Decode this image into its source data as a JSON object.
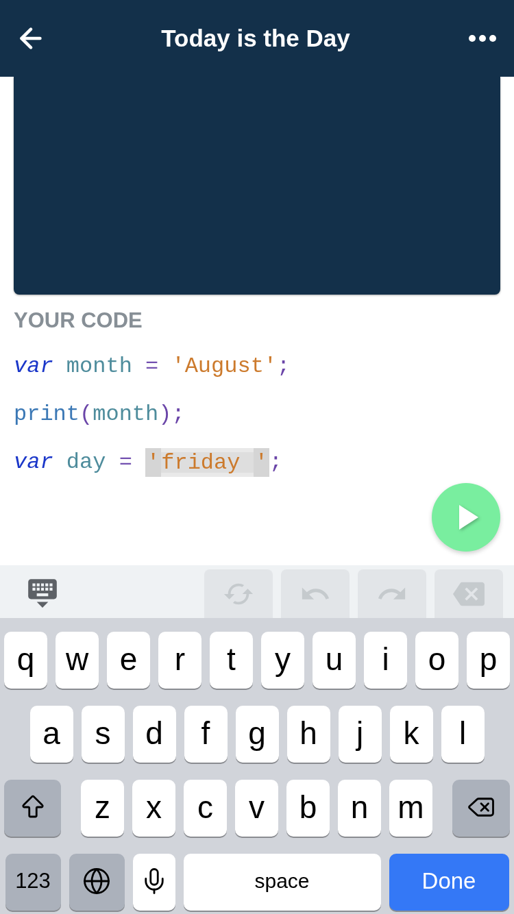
{
  "header": {
    "title": "Today is the Day"
  },
  "code": {
    "heading": "YOUR CODE",
    "lines": [
      {
        "tokens": [
          {
            "text": "var ",
            "kind": "keyword"
          },
          {
            "text": "month ",
            "kind": "identifier"
          },
          {
            "text": "= ",
            "kind": "operator"
          },
          {
            "text": "'August'",
            "kind": "string"
          },
          {
            "text": ";",
            "kind": "punctuation"
          }
        ]
      },
      {
        "tokens": [
          {
            "text": "print",
            "kind": "function"
          },
          {
            "text": "(",
            "kind": "punctuation"
          },
          {
            "text": "month",
            "kind": "identifier"
          },
          {
            "text": ")",
            "kind": "punctuation"
          },
          {
            "text": ";",
            "kind": "punctuation"
          }
        ]
      },
      {
        "tokens": [
          {
            "text": "var ",
            "kind": "keyword"
          },
          {
            "text": "day ",
            "kind": "identifier"
          },
          {
            "text": "= ",
            "kind": "operator"
          },
          {
            "text": "'friday '",
            "kind": "string_field"
          },
          {
            "text": ";",
            "kind": "punctuation"
          }
        ]
      }
    ]
  },
  "editor_toolbar": {
    "buttons": [
      {
        "kind": "refresh",
        "disabled": true
      },
      {
        "kind": "undo",
        "disabled": true
      },
      {
        "kind": "redo",
        "disabled": true
      },
      {
        "kind": "delete",
        "disabled": true
      }
    ]
  },
  "keyboard": {
    "rows": [
      {
        "keys": [
          {
            "label": "q",
            "kind": "letter"
          },
          {
            "label": "w",
            "kind": "letter"
          },
          {
            "label": "e",
            "kind": "letter"
          },
          {
            "label": "r",
            "kind": "letter"
          },
          {
            "label": "t",
            "kind": "letter"
          },
          {
            "label": "y",
            "kind": "letter"
          },
          {
            "label": "u",
            "kind": "letter"
          },
          {
            "label": "i",
            "kind": "letter"
          },
          {
            "label": "o",
            "kind": "letter"
          },
          {
            "label": "p",
            "kind": "letter"
          }
        ]
      },
      {
        "keys": [
          {
            "label": "a",
            "kind": "letter"
          },
          {
            "label": "s",
            "kind": "letter"
          },
          {
            "label": "d",
            "kind": "letter"
          },
          {
            "label": "f",
            "kind": "letter"
          },
          {
            "label": "g",
            "kind": "letter"
          },
          {
            "label": "h",
            "kind": "letter"
          },
          {
            "label": "j",
            "kind": "letter"
          },
          {
            "label": "k",
            "kind": "letter"
          },
          {
            "label": "l",
            "kind": "letter"
          }
        ]
      },
      {
        "keys": [
          {
            "kind": "shift"
          },
          {
            "label": "z",
            "kind": "letter"
          },
          {
            "label": "x",
            "kind": "letter"
          },
          {
            "label": "c",
            "kind": "letter"
          },
          {
            "label": "v",
            "kind": "letter"
          },
          {
            "label": "b",
            "kind": "letter"
          },
          {
            "label": "n",
            "kind": "letter"
          },
          {
            "label": "m",
            "kind": "letter"
          },
          {
            "kind": "backspace"
          }
        ]
      },
      {
        "keys": [
          {
            "label": "123",
            "kind": "numbers"
          },
          {
            "kind": "globe"
          },
          {
            "kind": "mic"
          },
          {
            "label": "space",
            "kind": "space"
          },
          {
            "label": "Done",
            "kind": "done"
          }
        ]
      }
    ]
  }
}
